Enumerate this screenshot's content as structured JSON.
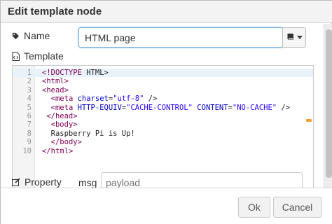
{
  "dialog": {
    "title": "Edit template node"
  },
  "fields": {
    "name_label": "Name",
    "name_value": "HTML page",
    "template_label": "Template",
    "property_label": "Property",
    "property_prefix": "msg",
    "property_placeholder": "payload"
  },
  "editor": {
    "lines": [
      {
        "n": "1",
        "text": "<!DOCTYPE HTML>"
      },
      {
        "n": "2",
        "text": "<html>"
      },
      {
        "n": "3",
        "text": "<head>"
      },
      {
        "n": "4",
        "text": "  <meta charset=\"utf-8\" />"
      },
      {
        "n": "5",
        "text": "  <meta HTTP-EQUIV=\"CACHE-CONTROL\" CONTENT=\"NO-CACHE\" />"
      },
      {
        "n": "6",
        "text": " </head>"
      },
      {
        "n": "7",
        "text": "  <body>"
      },
      {
        "n": "8",
        "text": "  Raspberry Pi is Up!"
      },
      {
        "n": "9",
        "text": "  </body>"
      },
      {
        "n": "10",
        "text": "</html>"
      }
    ]
  },
  "buttons": {
    "ok": "Ok",
    "cancel": "Cancel"
  },
  "icons": {
    "name": "tag-icon",
    "template": "file-code-icon",
    "property": "pencil-icon",
    "config": "book-icon"
  },
  "colors": {
    "focus_border": "#6aa8d8",
    "tag": "#7f0055",
    "attr": "#0000cc",
    "string": "#2a00ff",
    "active_line": "#e8f2fb",
    "marker": "#f0a030"
  }
}
